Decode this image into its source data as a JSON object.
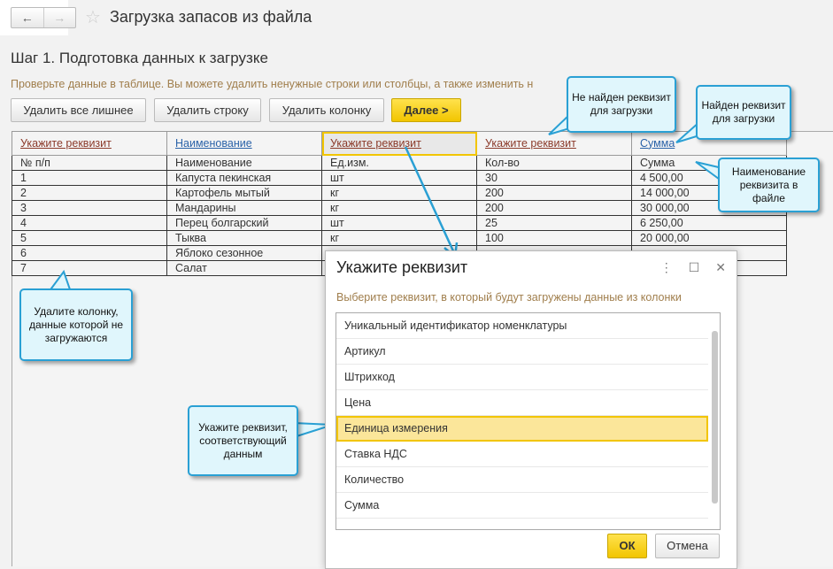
{
  "header": {
    "title": "Загрузка запасов из файла",
    "back_icon": "arrow-left",
    "forward_icon": "arrow-right",
    "favorite_icon": "star"
  },
  "step": {
    "title": "Шаг 1. Подготовка данных к загрузке",
    "hint": "Проверьте данные в таблице. Вы можете удалить ненужные строки или столбцы, а также изменить н"
  },
  "toolbar": {
    "remove_extra": "Удалить все лишнее",
    "remove_row": "Удалить строку",
    "remove_column": "Удалить колонку",
    "next": "Далее >"
  },
  "table": {
    "mapping": [
      "Укажите реквизит",
      "Наименование",
      "Укажите реквизит",
      "Укажите реквизит",
      "Сумма"
    ],
    "rows": [
      [
        "№ п/п",
        "Наименование",
        "Ед.изм.",
        "Кол-во",
        "Сумма"
      ],
      [
        "1",
        "Капуста  пекинская",
        "шт",
        "30",
        "4 500,00"
      ],
      [
        "2",
        "Картофель мытый",
        "кг",
        "200",
        "14 000,00"
      ],
      [
        "3",
        "Мандарины",
        "кг",
        "200",
        "30 000,00"
      ],
      [
        "4",
        "Перец болгарский",
        "шт",
        "25",
        "6 250,00"
      ],
      [
        "5",
        "Тыква",
        "кг",
        "100",
        "20 000,00"
      ],
      [
        "6",
        "Яблоко сезонное",
        "",
        "",
        ""
      ],
      [
        "7",
        "Салат",
        "",
        "",
        ""
      ]
    ]
  },
  "callouts": {
    "not_found": "Не найден реквизит для загрузки",
    "found": "Найден реквизит для загрузки",
    "file_name": "Наименование реквизита в файле",
    "delete_column": "Удалите колонку, данные которой не загружаются",
    "specify": "Укажите реквизит, соответствующий данным"
  },
  "dialog": {
    "title": "Укажите реквизит",
    "hint": "Выберите реквизит, в который будут загружены данные из колонки",
    "items": [
      "Уникальный идентификатор номенклатуры",
      "Артикул",
      "Штрихкод",
      "Цена",
      "Единица измерения",
      "Ставка НДС",
      "Количество",
      "Сумма"
    ],
    "selected": "Единица измерения",
    "ok": "ОК",
    "cancel": "Отмена"
  },
  "colors": {
    "accent": "#f2c500",
    "callout_border": "#2aa0d4",
    "callout_bg": "#e0f6fc"
  }
}
